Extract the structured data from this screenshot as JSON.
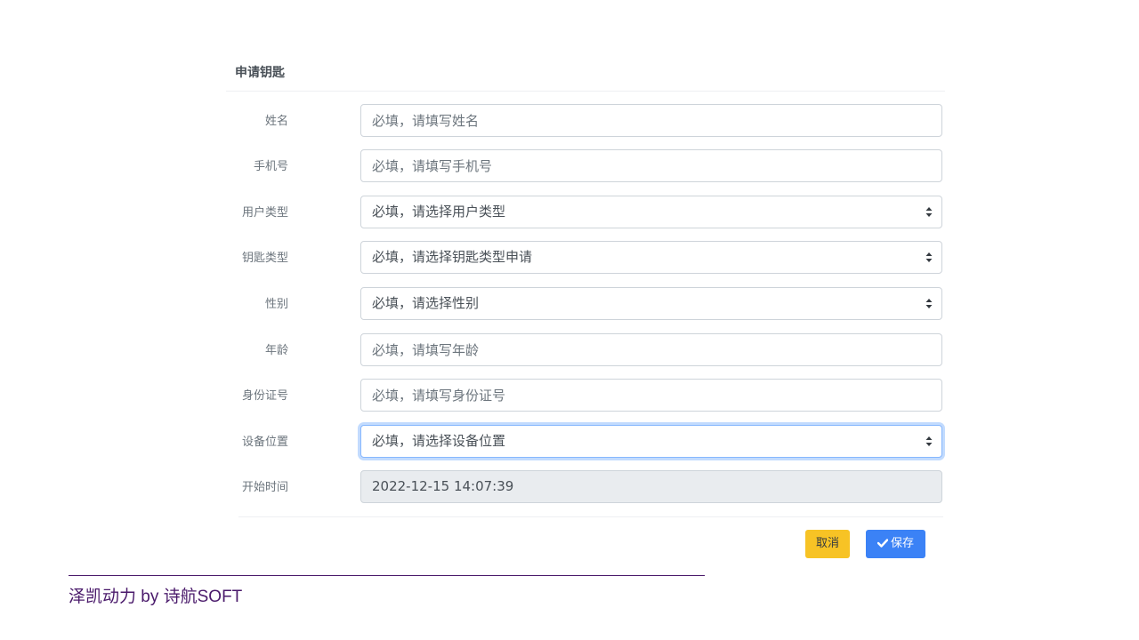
{
  "card": {
    "title": "申请钥匙"
  },
  "form": {
    "name": {
      "label": "姓名",
      "placeholder": "必填，请填写姓名"
    },
    "phone": {
      "label": "手机号",
      "placeholder": "必填，请填写手机号"
    },
    "user_type": {
      "label": "用户类型",
      "selected": "必填，请选择用户类型"
    },
    "key_type": {
      "label": "钥匙类型",
      "selected": "必填，请选择钥匙类型申请"
    },
    "gender": {
      "label": "性别",
      "selected": "必填，请选择性别"
    },
    "age": {
      "label": "年龄",
      "placeholder": "必填，请填写年龄"
    },
    "id_number": {
      "label": "身份证号",
      "placeholder": "必填，请填写身份证号"
    },
    "device_location": {
      "label": "设备位置",
      "selected": "必填，请选择设备位置"
    },
    "start_time": {
      "label": "开始时间",
      "value": "2022-12-15 14:07:39"
    }
  },
  "actions": {
    "cancel_label": "取消",
    "save_label": "保存"
  },
  "footer": {
    "text": "泽凯动力 by 诗航SOFT"
  },
  "colors": {
    "cancel_button": "#f7c325",
    "save_button": "#3b82f6",
    "footer_text": "#4a1a6b",
    "focus_border": "#86b7fe"
  },
  "icons": {
    "select_caret": "caret-up-down-icon",
    "save": "check-icon"
  }
}
